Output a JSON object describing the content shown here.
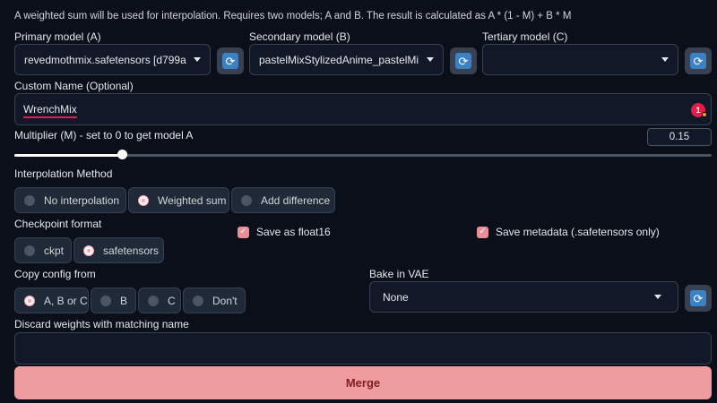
{
  "description": "A weighted sum will be used for interpolation. Requires two models; A and B. The result is calculated as A * (1 - M) + B * M",
  "primary": {
    "label": "Primary model (A)",
    "value": "revedmothmix.safetensors [d799a"
  },
  "secondary": {
    "label": "Secondary model (B)",
    "value": "pastelMixStylizedAnime_pastelMi:"
  },
  "tertiary": {
    "label": "Tertiary model (C)",
    "value": ""
  },
  "custom_name": {
    "label": "Custom Name (Optional)",
    "value": "WrenchMix",
    "badge": "1"
  },
  "multiplier": {
    "label": "Multiplier (M) - set to 0 to get model A",
    "value": "0.15",
    "level": 0.15
  },
  "interpolation": {
    "label": "Interpolation Method",
    "options": [
      "No interpolation",
      "Weighted sum",
      "Add difference"
    ],
    "selected": "Weighted sum"
  },
  "checkpoint_format": {
    "label": "Checkpoint format",
    "options": [
      "ckpt",
      "safetensors"
    ],
    "selected": "safetensors"
  },
  "save_float16": {
    "label": "Save as float16",
    "checked": true
  },
  "save_metadata": {
    "label": "Save metadata (.safetensors only)",
    "checked": true
  },
  "copy_config": {
    "label": "Copy config from",
    "options": [
      "A, B or C",
      "B",
      "C",
      "Don't"
    ],
    "selected": "A, B or C"
  },
  "bake_vae": {
    "label": "Bake in VAE",
    "value": "None"
  },
  "discard": {
    "label": "Discard weights with matching name",
    "value": ""
  },
  "merge_label": "Merge",
  "colors": {
    "accent": "#ef9ca0",
    "background": "#0b0f19",
    "refresh": "#3b82c4"
  }
}
